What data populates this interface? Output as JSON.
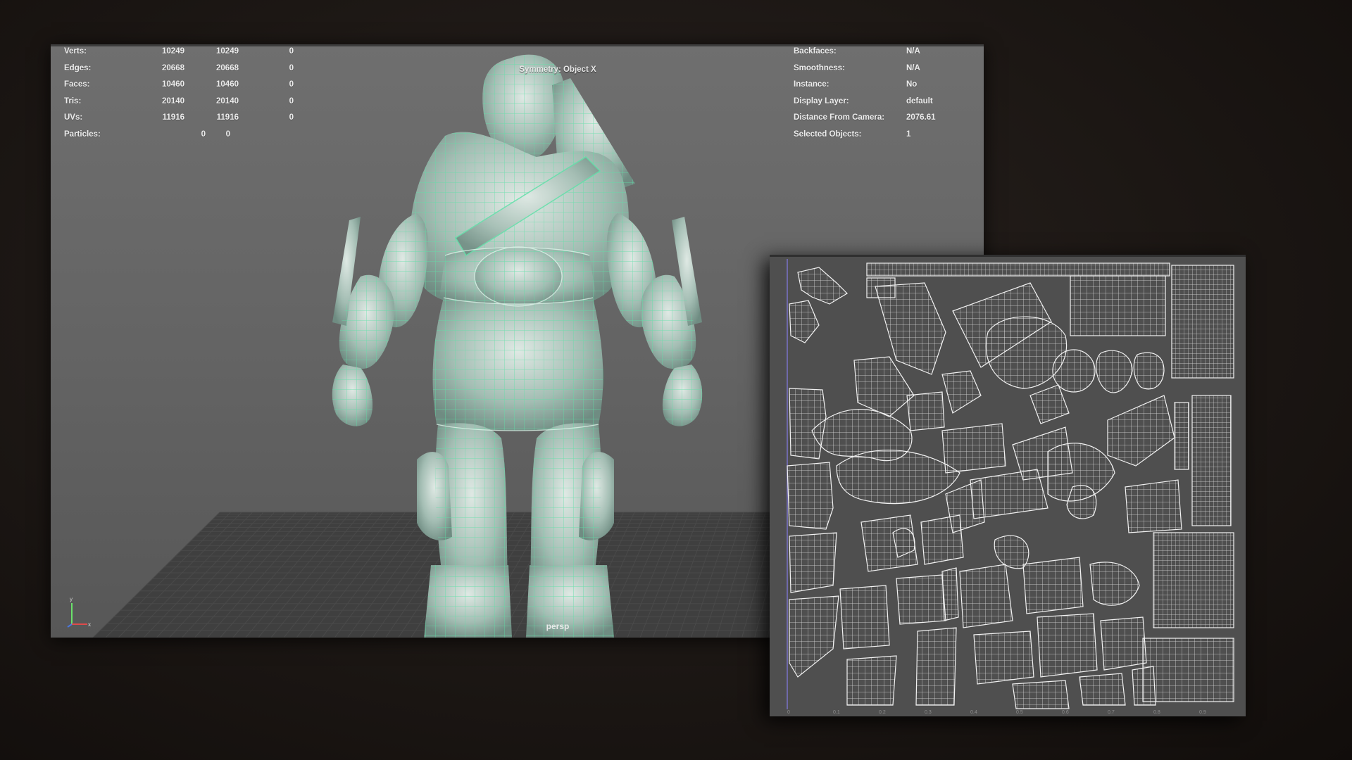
{
  "viewport": {
    "stats": [
      {
        "label": "Verts:",
        "v1": "10249",
        "v2": "10249",
        "v3": "0"
      },
      {
        "label": "Edges:",
        "v1": "20668",
        "v2": "20668",
        "v3": "0"
      },
      {
        "label": "Faces:",
        "v1": "10460",
        "v2": "10460",
        "v3": "0"
      },
      {
        "label": "Tris:",
        "v1": "20140",
        "v2": "20140",
        "v3": "0"
      },
      {
        "label": "UVs:",
        "v1": "11916",
        "v2": "11916",
        "v3": "0"
      },
      {
        "label": "Particles:",
        "v1": "0",
        "v2": "0",
        "v3": ""
      }
    ],
    "info": [
      {
        "label": "Backfaces:",
        "value": "N/A"
      },
      {
        "label": "Smoothness:",
        "value": "N/A"
      },
      {
        "label": "Instance:",
        "value": "No"
      },
      {
        "label": "Display Layer:",
        "value": "default"
      },
      {
        "label": "Distance From Camera:",
        "value": "2076.61"
      },
      {
        "label": "Selected Objects:",
        "value": "1"
      }
    ],
    "symmetry": "Symmetry: Object X",
    "camera": "persp"
  },
  "uv_editor": {
    "ticks": [
      "0",
      "0.1",
      "0.2",
      "0.3",
      "0.4",
      "0.5",
      "0.6",
      "0.7",
      "0.8",
      "0.9"
    ]
  },
  "colors": {
    "wireframe": "#5fe0a8",
    "mesh_fill": "#a9c7bc",
    "uv_lines": "#f2f2f2",
    "viewport_bg": "#666666",
    "uv_bg": "#4f4f4f"
  },
  "icons": {
    "axis": "axis-gizmo-icon"
  }
}
